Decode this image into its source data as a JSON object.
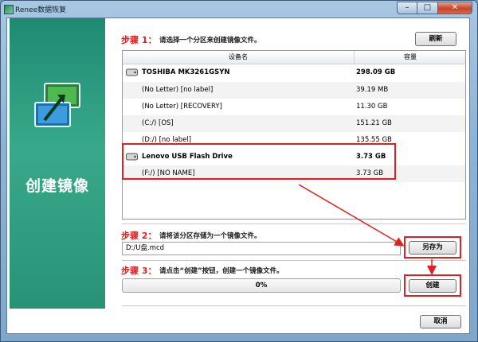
{
  "window": {
    "title": "Renee数据恢复"
  },
  "sidebar": {
    "title": "创建镜像"
  },
  "step1": {
    "label": "步骤 1：",
    "text": "请选择一个分区来创建镜像文件。",
    "refresh_label": "刷新"
  },
  "table": {
    "headers": {
      "device": "设备名",
      "capacity": "容量"
    },
    "rows": [
      {
        "name": "TOSHIBA MK3261GSYN",
        "size": "298.09 GB",
        "type": "disk"
      },
      {
        "name": "(No Letter) [no label]",
        "size": "39.19 MB",
        "type": "partition"
      },
      {
        "name": "(No Letter) [RECOVERY]",
        "size": "11.30 GB",
        "type": "partition"
      },
      {
        "name": "(C:/) [OS]",
        "size": "151.21 GB",
        "type": "partition"
      },
      {
        "name": "(D:/) [no label]",
        "size": "135.55 GB",
        "type": "partition"
      },
      {
        "name": "Lenovo USB Flash Drive",
        "size": "3.73 GB",
        "type": "disk"
      },
      {
        "name": "(F:/) [NO NAME]",
        "size": "3.73 GB",
        "type": "partition"
      }
    ]
  },
  "step2": {
    "label": "步骤 2：",
    "text": "请将该分区存储为一个镜像文件。",
    "path_value": "D:/U盘.mcd",
    "saveas_label": "另存为"
  },
  "step3": {
    "label": "步骤 3：",
    "text": "请点击“创建”按钮，创建一个镜像文件。",
    "progress_text": "0%",
    "progress": 0,
    "create_label": "创建"
  },
  "footer": {
    "cancel_label": "取消"
  },
  "colors": {
    "accent_red": "#e02020",
    "sidebar_green": "#2a9276"
  }
}
